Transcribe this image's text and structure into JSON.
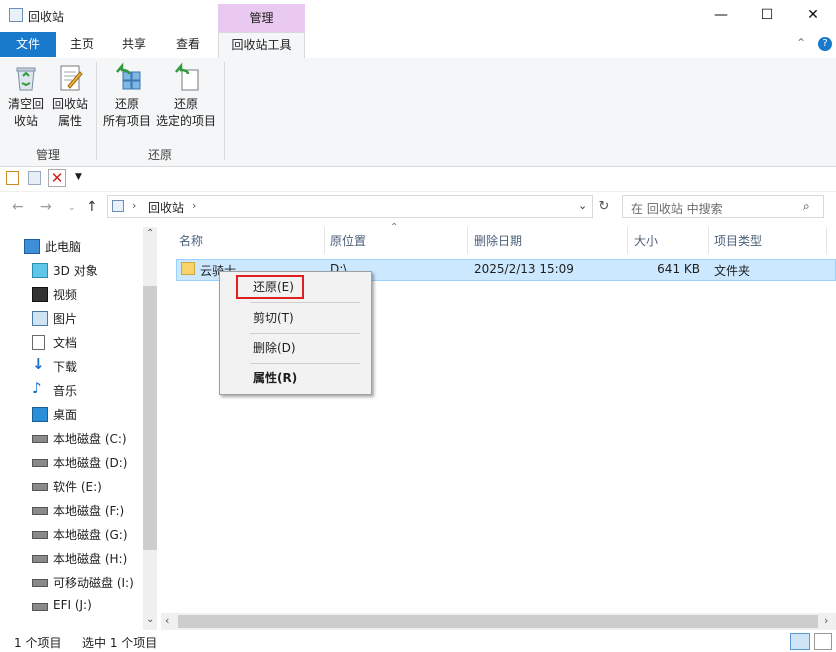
{
  "window": {
    "title": "回收站",
    "minimize_glyph": "—",
    "maximize_glyph": "☐",
    "close_glyph": "✕"
  },
  "ribbon_tabs": {
    "context_group": "管理",
    "file": "文件",
    "home": "主页",
    "share": "共享",
    "view": "查看",
    "tools": "回收站工具"
  },
  "ribbon": {
    "empty_line1": "清空回",
    "empty_line2": "收站",
    "props_line1": "回收站",
    "props_line2": "属性",
    "group_manage": "管理",
    "restore_all_line1": "还原",
    "restore_all_line2": "所有项目",
    "restore_sel_line1": "还原",
    "restore_sel_line2": "选定的项目",
    "group_restore": "还原"
  },
  "address": {
    "path": "回收站",
    "search_placeholder": "在 回收站 中搜索"
  },
  "nav": {
    "items": [
      {
        "label": "此电脑",
        "icon": "computer-icon"
      },
      {
        "label": "3D 对象",
        "icon": "3d-objects-icon"
      },
      {
        "label": "视频",
        "icon": "video-icon"
      },
      {
        "label": "图片",
        "icon": "pictures-icon"
      },
      {
        "label": "文档",
        "icon": "documents-icon"
      },
      {
        "label": "下载",
        "icon": "download-icon"
      },
      {
        "label": "音乐",
        "icon": "music-icon"
      },
      {
        "label": "桌面",
        "icon": "desktop-icon"
      },
      {
        "label": "本地磁盘 (C:)",
        "icon": "drive-icon"
      },
      {
        "label": "本地磁盘 (D:)",
        "icon": "drive-icon"
      },
      {
        "label": "软件 (E:)",
        "icon": "drive-icon"
      },
      {
        "label": "本地磁盘 (F:)",
        "icon": "drive-icon"
      },
      {
        "label": "本地磁盘 (G:)",
        "icon": "drive-icon"
      },
      {
        "label": "本地磁盘 (H:)",
        "icon": "drive-icon"
      },
      {
        "label": "可移动磁盘 (I:)",
        "icon": "removable-drive-icon"
      },
      {
        "label": "EFI (J:)",
        "icon": "drive-icon"
      }
    ]
  },
  "columns": {
    "name": "名称",
    "original_location": "原位置",
    "date_deleted": "删除日期",
    "size": "大小",
    "item_type": "项目类型"
  },
  "files": [
    {
      "name": "云骑士",
      "location": "D:\\",
      "date": "2025/2/13 15:09",
      "size": "641 KB",
      "type": "文件夹"
    }
  ],
  "context_menu": {
    "restore": "还原(E)",
    "cut": "剪切(T)",
    "delete": "删除(D)",
    "properties": "属性(R)"
  },
  "status": {
    "count": "1 个项目",
    "selected": "选中 1 个项目"
  },
  "colors": {
    "accent": "#1979ca",
    "context_tab": "#e9c9ef",
    "selection": "#cce8ff",
    "highlight_box": "#e02020"
  }
}
